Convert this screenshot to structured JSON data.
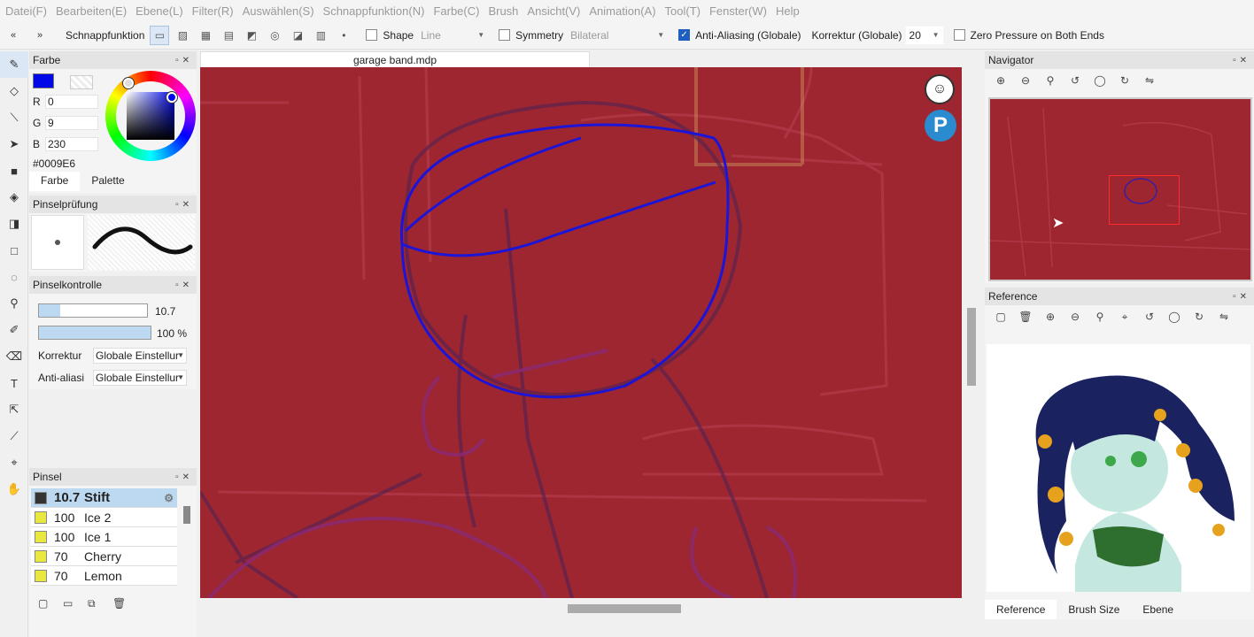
{
  "menu": [
    "Datei(F)",
    "Bearbeiten(E)",
    "Ebene(L)",
    "Filter(R)",
    "Auswählen(S)",
    "Schnappfunktion(N)",
    "Farbe(C)",
    "Brush",
    "Ansicht(V)",
    "Animation(A)",
    "Tool(T)",
    "Fenster(W)",
    "Help"
  ],
  "toolbar": {
    "prev_icon": "«",
    "next_icon": "»",
    "snap_label": "Schnappfunktion",
    "shape_label": "Shape",
    "shape_value": "Line",
    "symmetry_label": "Symmetry",
    "symmetry_value": "Bilateral",
    "antialias_label": "Anti-Aliasing (Globale)",
    "antialias_checked": true,
    "korrektur_label": "Korrektur (Globale)",
    "korrektur_value": "20",
    "zero_pressure_label": "Zero Pressure on Both Ends"
  },
  "farbe": {
    "title": "Farbe",
    "r_label": "R",
    "r_value": "0",
    "g_label": "G",
    "g_value": "9",
    "b_label": "B",
    "b_value": "230",
    "hex": "#0009E6",
    "tab_farbe": "Farbe",
    "tab_palette": "Palette"
  },
  "pinselpruefung": {
    "title": "Pinselprüfung"
  },
  "pinselkontrolle": {
    "title": "Pinselkontrolle",
    "size_value": "10.7",
    "size_fraction": 0.2,
    "opacity_value": "100 %",
    "opacity_fraction": 1.0,
    "korrektur_label": "Korrektur",
    "korrektur_value": "Globale Einstellur",
    "antialias_label": "Anti-aliasi",
    "antialias_value": "Globale Einstellur"
  },
  "pinsel": {
    "title": "Pinsel",
    "items": [
      {
        "size": "10.7",
        "name": "Stift",
        "selected": true
      },
      {
        "size": "100",
        "name": "Ice 2"
      },
      {
        "size": "100",
        "name": "Ice 1"
      },
      {
        "size": "70",
        "name": "Cherry"
      },
      {
        "size": "70",
        "name": "Lemon"
      }
    ]
  },
  "document": {
    "tab_title": "garage band.mdp"
  },
  "navigator": {
    "title": "Navigator"
  },
  "reference": {
    "title": "Reference"
  },
  "right_tabs": [
    "Reference",
    "Brush Size",
    "Ebene"
  ],
  "colors": {
    "canvas": "#9d2631",
    "primary": "#0009E6",
    "selection": "#bcd9f1",
    "accent": "#1e5fbf"
  }
}
